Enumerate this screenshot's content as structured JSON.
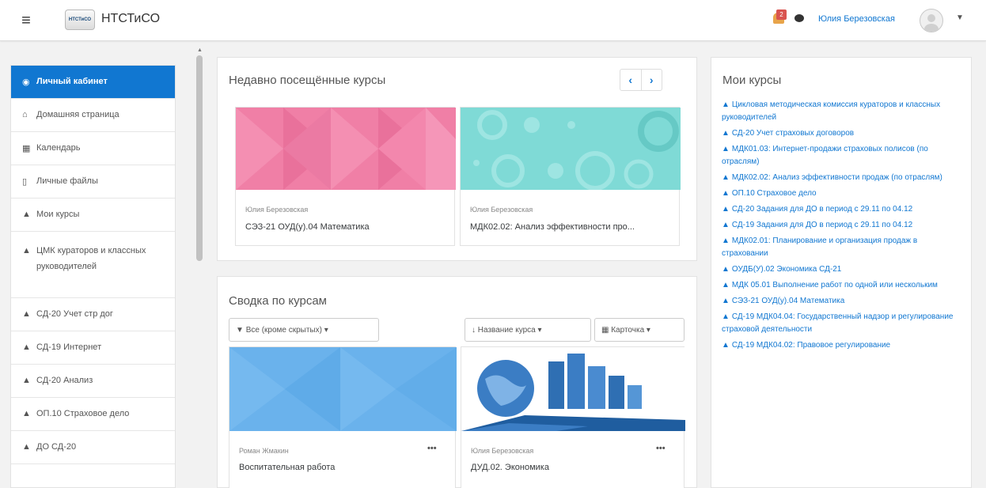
{
  "navbar": {
    "site_name": "НТСТиСО",
    "logo_text": "НТСТиСО",
    "notification_count": "2",
    "user_name": "Юлия Березовская"
  },
  "drawer": {
    "items": [
      {
        "icon": "dashboard-icon",
        "label": "Личный кабинет",
        "active": true
      },
      {
        "icon": "home-icon",
        "label": "Домашняя страница"
      },
      {
        "icon": "calendar-icon",
        "label": "Календарь"
      },
      {
        "icon": "file-icon",
        "label": "Личные файлы"
      },
      {
        "icon": "graduation-cap-icon",
        "label": "Мои курсы"
      },
      {
        "icon": "graduation-cap-icon",
        "label": "ЦМК кураторов и классных руководителей"
      },
      {
        "icon": "graduation-cap-icon",
        "label": "СД-20 Учет стр дог"
      },
      {
        "icon": "graduation-cap-icon",
        "label": "СД-19 Интернет"
      },
      {
        "icon": "graduation-cap-icon",
        "label": "СД-20 Анализ"
      },
      {
        "icon": "graduation-cap-icon",
        "label": "ОП.10 Страховое дело"
      },
      {
        "icon": "graduation-cap-icon",
        "label": "ДО СД-20"
      }
    ]
  },
  "recent": {
    "title": "Недавно посещённые курсы",
    "prev": "‹",
    "next": "›",
    "courses": [
      {
        "teacher": "Юлия Березовская",
        "name": "СЭЗ-21 ОУД(у).04 Математика",
        "color": "#f07fa6"
      },
      {
        "teacher": "Юлия Березовская",
        "name": "МДК02.02: Анализ эффективности про...",
        "color": "#7fdad6"
      }
    ]
  },
  "summary": {
    "title": "Сводка по курсам",
    "filter_label": "Все (кроме скрытых)",
    "sort_label": "Название курса",
    "view_label": "Карточка",
    "courses": [
      {
        "teacher": "Роман Жмакин",
        "name": "Воспитательная работа",
        "color": "#6ab2ec"
      },
      {
        "teacher": "Юлия Березовская",
        "name": "ДУД.02. Экономика",
        "color": "#3b7dc4"
      }
    ]
  },
  "mycourses": {
    "title": "Мои курсы",
    "items": [
      "Цикловая методическая комиссия кураторов и классных руководителей",
      "СД-20 Учет страховых договоров",
      "МДК01.03: Интернет-продажи страховых полисов (по отраслям)",
      "МДК02.02: Анализ эффективности продаж (по отраслям)",
      "ОП.10 Страховое дело",
      "СД-20 Задания для ДО в период с 29.11 по 04.12",
      "СД-19 Задания для ДО в период с 29.11 по 04.12",
      "МДК02.01: Планирование и организация продаж в страховании",
      "ОУДБ(У).02 Экономика СД-21",
      "МДК 05.01 Выполнение работ по одной или нескольким",
      "СЭЗ-21 ОУД(у).04 Математика",
      "СД-19 МДК04.04: Государственный надзор и регулирование страховой деятельности",
      "СД-19 МДК04.02: Правовое регулирование"
    ]
  },
  "colors": {
    "accent": "#1177d1",
    "badge": "#d9534f"
  }
}
